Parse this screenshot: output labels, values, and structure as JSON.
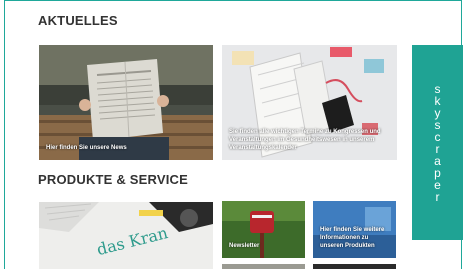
{
  "sections": {
    "news": {
      "title": "AKTUELLES"
    },
    "products": {
      "title": "PRODUKTE & SERVICE"
    }
  },
  "cards": {
    "news": {
      "caption": "Hier finden Sie unsere News"
    },
    "calendar": {
      "caption": "Sie finden alle wichtigen Termine zu Kongressen und Veranstaltungen im Gesundheitswesen in unserem Veranstaltungskalender"
    },
    "newsletter": {
      "caption": "Newsletter"
    },
    "products": {
      "caption": "Hier finden Sie weitere Informationen zu unseren Produkten"
    },
    "brand": {
      "watermark": "das Kran"
    }
  },
  "skyscraper": {
    "letters": [
      "s",
      "k",
      "y",
      "s",
      "c",
      "r",
      "a",
      "p",
      "e",
      "r"
    ]
  },
  "colors": {
    "accent": "#1fa394"
  }
}
